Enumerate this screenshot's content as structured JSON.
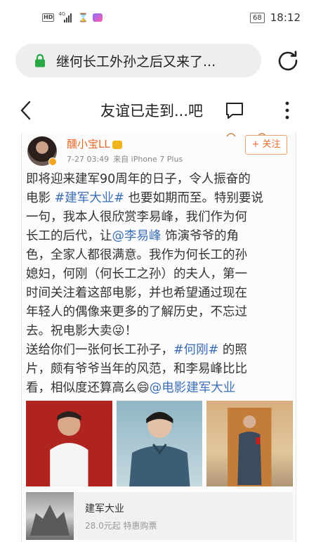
{
  "status_bar": {
    "hd": "HD",
    "network": "4G",
    "battery": "68",
    "time": "18:12"
  },
  "url_bar": {
    "text": "继何长工外孙之后又来了..."
  },
  "title_bar": {
    "title": "友谊已走到...吧"
  },
  "post": {
    "author": "醺小宝LL",
    "date": "7-27 03:49",
    "source": "来自 iPhone 7 Plus",
    "follow_label": "+ 关注",
    "lines": [
      [
        "即将迎来建军90周年的日子，令人振奋的"
      ],
      [
        "电影 ",
        "#建军大业#",
        " 也要如期而至。特别要说"
      ],
      [
        "一句，我本人很欣赏李易峰，我们作为何"
      ],
      [
        "长工的后代，让",
        "@李易峰",
        " 饰演爷爷的角"
      ],
      [
        "色，全家人都很满意。我作为何长工的孙"
      ],
      [
        "媳妇，何刚（何长工之孙）的夫人，第一"
      ],
      [
        "时间关注着这部电影，并也希望通过现在"
      ],
      [
        "年轻人的偶像来更多的了解历史，不忘过"
      ],
      [
        "去。祝电影大卖",
        "😜",
        "！"
      ],
      [
        "送给你们一张何长工孙子，",
        "#何刚#",
        " 的照"
      ],
      [
        "片，颇有爷爷当年的风范，和李易峰比比"
      ],
      [
        "看，相似度还算高么",
        "😄",
        "@电影建军大业"
      ]
    ],
    "movie_card": {
      "title": "建军大业",
      "price": "28.0元起 特惠购票"
    }
  },
  "colors": {
    "link": "#3b6fb7",
    "author": "#e86a2b"
  },
  "icons": [
    "lock-icon",
    "refresh-icon",
    "back-icon",
    "comment-icon",
    "more-icon"
  ]
}
